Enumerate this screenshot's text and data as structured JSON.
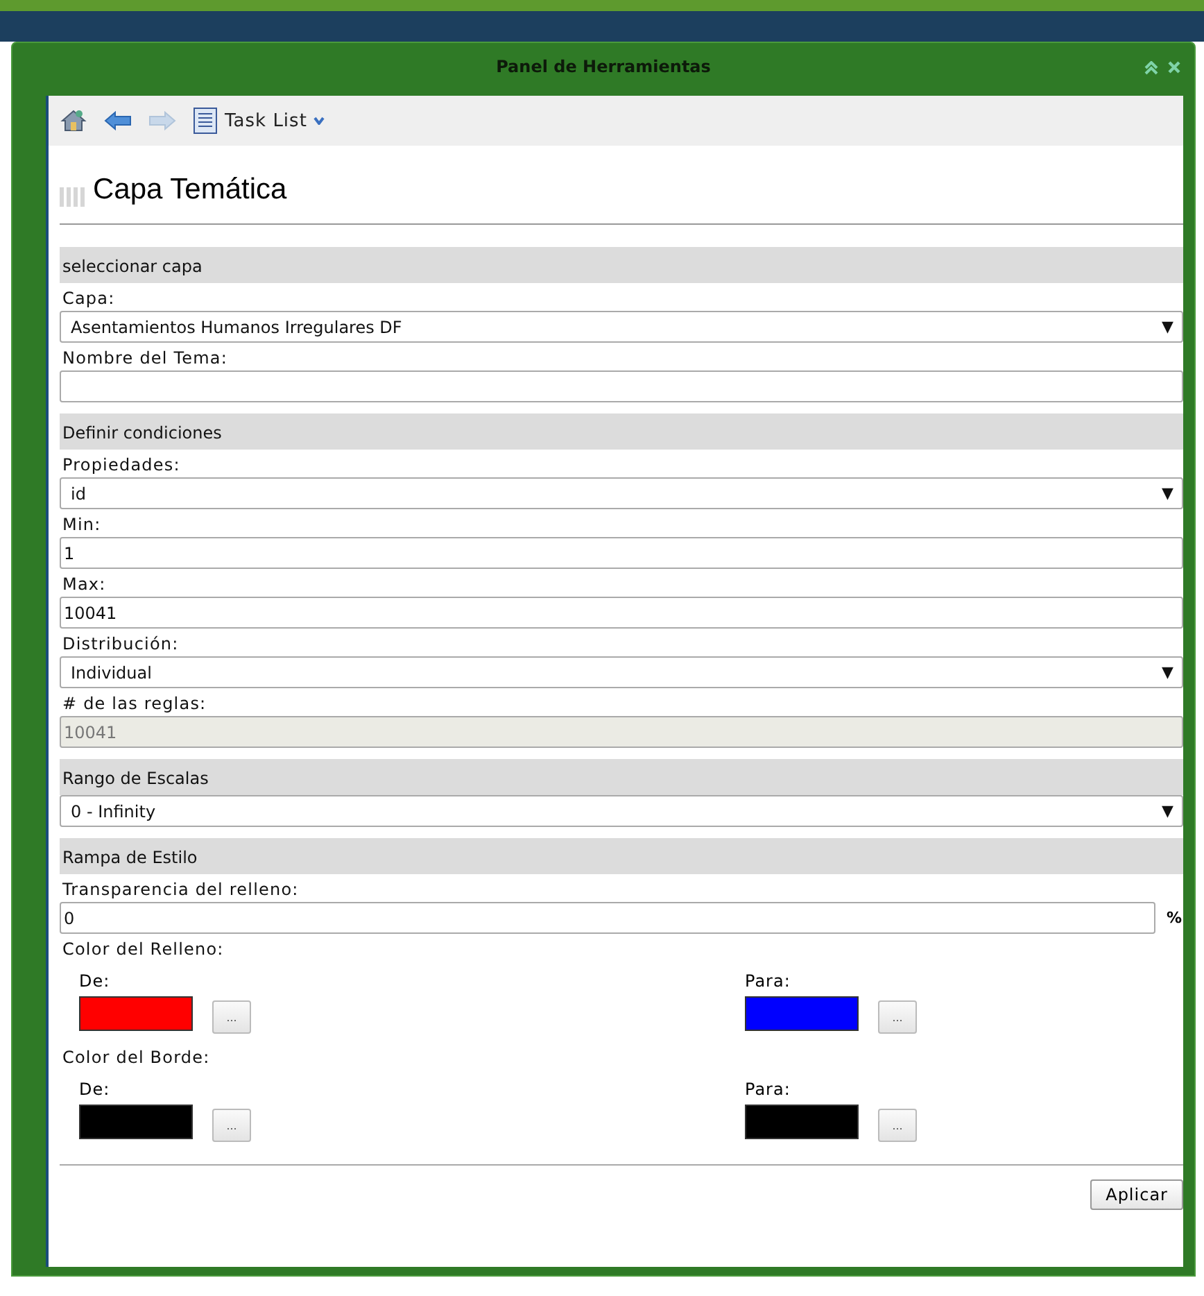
{
  "window": {
    "title": "Panel de Herramientas"
  },
  "toolbar": {
    "nav": [
      {
        "kind": "back",
        "disabled": false
      },
      {
        "kind": "forward",
        "disabled": true
      }
    ],
    "menu": "Task List"
  },
  "heading": "Capa Temática",
  "form": [
    {
      "kind": "section",
      "text": "seleccionar capa"
    },
    {
      "kind": "label",
      "text": "Capa:"
    },
    {
      "kind": "select",
      "value": "Asentamientos Humanos Irregulares DF",
      "arrow": "▼"
    },
    {
      "kind": "label",
      "text": "Nombre del Tema:"
    },
    {
      "kind": "input",
      "disabled": false
    },
    {
      "kind": "section",
      "text": "Definir condiciones"
    },
    {
      "kind": "label",
      "text": "Propiedades:"
    },
    {
      "kind": "select",
      "value": "id",
      "arrow": "▼"
    },
    {
      "kind": "label",
      "text": "Min:"
    },
    {
      "kind": "input",
      "value": "1",
      "disabled": false
    },
    {
      "kind": "label",
      "text": "Max:"
    },
    {
      "kind": "input",
      "value": "10041",
      "disabled": false
    },
    {
      "kind": "label",
      "text": "Distribución:"
    },
    {
      "kind": "select",
      "value": "Individual",
      "arrow": "▼"
    },
    {
      "kind": "label",
      "text": "# de las reglas:"
    },
    {
      "kind": "input",
      "value": "10041",
      "disabled": true
    },
    {
      "kind": "section",
      "text": "Rango de Escalas"
    },
    {
      "kind": "select",
      "value": "0 - Infinity",
      "arrow": "▼"
    },
    {
      "kind": "section",
      "text": "Rampa de Estilo"
    },
    {
      "kind": "label",
      "text": "Transparencia del relleno:"
    },
    {
      "kind": "input",
      "value": "0",
      "suffix": "%",
      "disabled": false
    },
    {
      "kind": "label",
      "text": "Color del Relleno:"
    },
    {
      "kind": "colors",
      "from": {
        "label": "De:",
        "color": "#ff0000",
        "button": "..."
      },
      "to": {
        "label": "Para:",
        "color": "#0000ff",
        "button": "..."
      }
    },
    {
      "kind": "label",
      "text": "Color del Borde:"
    },
    {
      "kind": "colors",
      "from": {
        "label": "De:",
        "color": "#000000",
        "button": "..."
      },
      "to": {
        "label": "Para:",
        "color": "#000000",
        "button": "..."
      }
    }
  ],
  "apply": "Aplicar"
}
